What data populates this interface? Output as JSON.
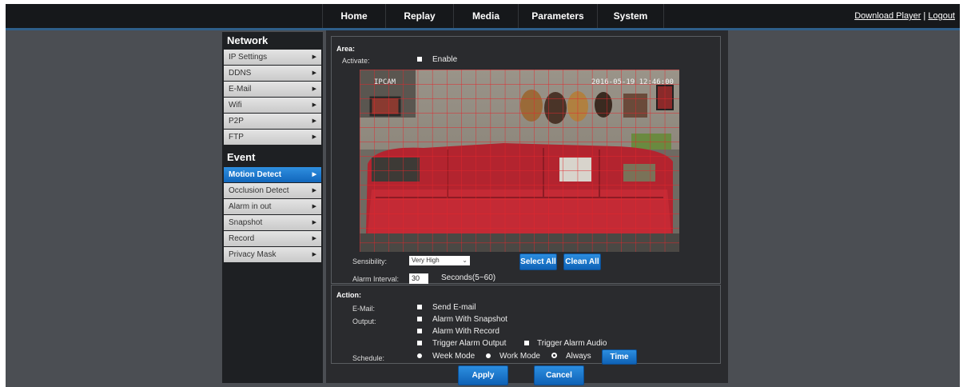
{
  "nav": {
    "items": [
      "Home",
      "Replay",
      "Media",
      "Parameters",
      "System"
    ],
    "links": {
      "download": "Download Player",
      "separator": "|",
      "logout": "Logout"
    }
  },
  "sidebar": {
    "network_header": "Network",
    "network_items": [
      "IP Settings",
      "DDNS",
      "E-Mail",
      "Wifi",
      "P2P",
      "FTP"
    ],
    "event_header": "Event",
    "event_items": [
      "Motion Detect",
      "Occlusion Detect",
      "Alarm in out",
      "Snapshot",
      "Record",
      "Privacy Mask"
    ],
    "active_item": "Motion Detect",
    "arrow_icon": "chevron-right-icon"
  },
  "area": {
    "title": "Area:",
    "activate_label": "Activate:",
    "enable_label": "Enable",
    "enable_checked": true,
    "camera_overlay_left": "IPCAM",
    "camera_overlay_time": "2016-05-19 12:46:00",
    "sensibility_label": "Sensibility:",
    "sensibility_value": "Very High",
    "select_all": "Select All",
    "clean_all": "Clean All",
    "alarm_interval_label": "Alarm Interval:",
    "alarm_interval_value": "30",
    "alarm_interval_unit": "Seconds(5~60)"
  },
  "action": {
    "title": "Action:",
    "email_label": "E-Mail:",
    "send_email": "Send E-mail",
    "output_label": "Output:",
    "alarm_snapshot": "Alarm With Snapshot",
    "alarm_record": "Alarm With Record",
    "trigger_output": "Trigger Alarm Output",
    "trigger_audio": "Trigger Alarm Audio",
    "schedule_label": "Schedule:",
    "week_mode": "Week Mode",
    "work_mode": "Work Mode",
    "always": "Always",
    "selected_schedule": "Always",
    "time_button": "Time"
  },
  "footer": {
    "apply": "Apply",
    "cancel": "Cancel"
  },
  "colors": {
    "accent": "#1a74c9",
    "grid": "#e3262c",
    "sofa": "#b3242f",
    "panel": "#2a2b2e"
  }
}
